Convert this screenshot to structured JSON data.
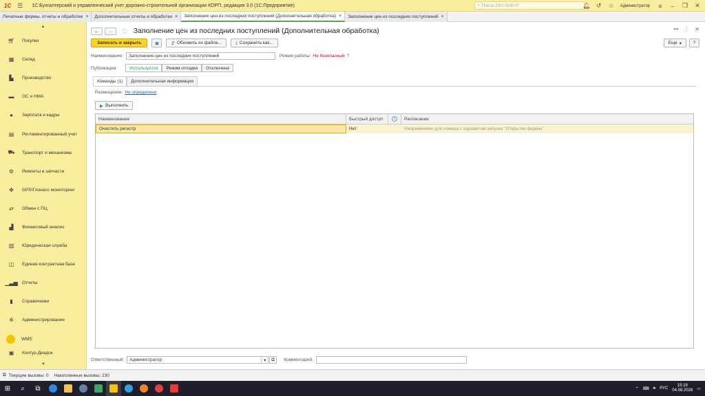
{
  "titlebar": {
    "logo": "1C",
    "app_title": "1С:Бухгалтерский и управленческий учет дорожно-строительной организации КОРП, редакция 3.0  (1С:Предприятие)",
    "search_placeholder": "Поиск Ctrl+Shift+F",
    "user": "Администратор"
  },
  "tabs": [
    {
      "label": "Печатные формы, отчеты и обработки"
    },
    {
      "label": "Дополнительные отчеты и обработки"
    },
    {
      "label": "Заполнение цен из последних поступлений (Дополнительная обработка)"
    },
    {
      "label": "Заполнение цен из последних поступлений"
    }
  ],
  "sidebar": {
    "items": [
      {
        "label": "Покупки",
        "icon": "cart-icon"
      },
      {
        "label": "Склад",
        "icon": "warehouse-icon"
      },
      {
        "label": "Производство",
        "icon": "factory-icon"
      },
      {
        "label": "ОС и НМА",
        "icon": "truck-icon"
      },
      {
        "label": "Зарплата и кадры",
        "icon": "person-icon"
      },
      {
        "label": "Регламентированный учет",
        "icon": "ledger-icon"
      },
      {
        "label": "Транспорт и механизмы",
        "icon": "excavator-icon"
      },
      {
        "label": "Ремонты и запчасти",
        "icon": "gear-icon"
      },
      {
        "label": "GPS\\Глонасс мониторинг",
        "icon": "satellite-icon"
      },
      {
        "label": "Обмен с ПЦ",
        "icon": "exchange-icon"
      },
      {
        "label": "Финансовый анализ",
        "icon": "analysis-icon"
      },
      {
        "label": "Юридическая служба",
        "icon": "legal-icon"
      },
      {
        "label": "Единая контрактная база",
        "icon": "book-icon"
      },
      {
        "label": "Отчеты",
        "icon": "chart-icon"
      },
      {
        "label": "Справочники",
        "icon": "catalog-icon"
      },
      {
        "label": "Администрирование",
        "icon": "settings-icon"
      },
      {
        "label": "WMS",
        "icon": "wms-circle-icon"
      },
      {
        "label": "Контур.Диадок",
        "icon": "diadoc-icon"
      }
    ]
  },
  "form": {
    "title": "Заполнение цен из последних поступлений (Дополнительная обработка)",
    "save_close": "Записать и закрыть",
    "update_from_file": "Обновить из файла...",
    "save_as": "Сохранить как...",
    "more": "Еще",
    "help": "?",
    "name_label": "Наименование:",
    "name_value": "Заполнение цен из последних поступлений",
    "mode_label": "Режим работы:",
    "mode_value": "Не безопасный",
    "mode_help": "?",
    "publication_label": "Публикация:",
    "publication_options": [
      "Используется",
      "Режим отладки",
      "Отключена"
    ],
    "subtabs": [
      "Команды (1)",
      "Дополнительная информация"
    ],
    "placement_label": "Размещение:",
    "placement_value": "Не определено",
    "run_button": "Выполнить",
    "grid_headers": [
      "Наименование",
      "Быстрый доступ",
      "",
      "Расписание"
    ],
    "grid_rows": [
      {
        "name": "Очистить регистр",
        "quick": "Нет",
        "schedule": "Неприменимо для команд с вариантом запуска \"Открытие формы\""
      }
    ],
    "responsible_label": "Ответственный:",
    "responsible_value": "Администратор",
    "comment_label": "Комментарий:",
    "comment_value": ""
  },
  "status": {
    "current_calls": "Текущие вызовы: 0",
    "accumulated_calls": "Накопленные вызовы: 230"
  },
  "taskbar": {
    "lang": "РУС",
    "time": "15:19",
    "date": "04.08.2026"
  }
}
